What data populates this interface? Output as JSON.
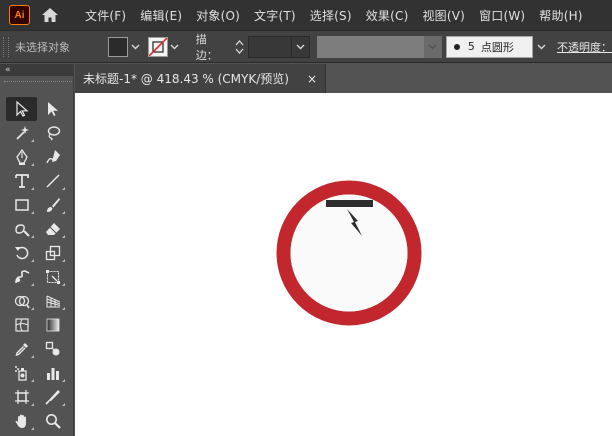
{
  "app": {
    "logo_text": "Ai"
  },
  "menu": [
    "文件(F)",
    "编辑(E)",
    "对象(O)",
    "文字(T)",
    "选择(S)",
    "效果(C)",
    "视图(V)",
    "窗口(W)",
    "帮助(H)"
  ],
  "control": {
    "selection_label": "未选择对象",
    "stroke_label": "描边：",
    "brush": {
      "size": "5",
      "shape": "点圆形"
    },
    "opacity_label": "不透明度："
  },
  "document": {
    "tab_title": "未标题-1* @ 418.43 % (CMYK/预览)",
    "close_glyph": "×"
  },
  "toolbar": {
    "collapse_glyph": "«",
    "tools": [
      "selection-tool",
      "direct-selection-tool",
      "magic-wand-tool",
      "lasso-tool",
      "pen-tool",
      "curvature-tool",
      "type-tool",
      "line-segment-tool",
      "rectangle-tool",
      "paintbrush-tool",
      "shaper-tool",
      "eraser-tool",
      "rotate-tool",
      "scale-tool",
      "warp-tool",
      "free-transform-tool",
      "shape-builder-tool",
      "perspective-grid-tool",
      "mesh-tool",
      "gradient-tool",
      "eyedropper-tool",
      "blend-tool",
      "symbol-sprayer-tool",
      "column-graph-tool",
      "artboard-tool",
      "slice-tool",
      "hand-tool",
      "zoom-tool"
    ]
  },
  "artwork": {
    "ring_color": "#c1272d",
    "face_color": "#fafafa",
    "bar_color": "#2d2d2d"
  }
}
